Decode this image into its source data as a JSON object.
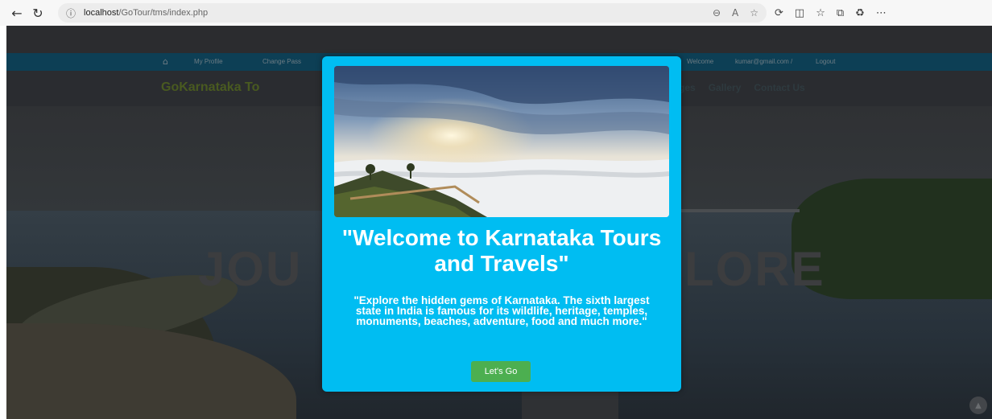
{
  "browser": {
    "back_icon": "←",
    "refresh_icon": "↻",
    "info_icon": "ⓘ",
    "url_host": "localhost",
    "url_path": "/GoTour/tms/index.php",
    "zoom_icon": "⊖",
    "read_aloud_icon": "A",
    "favorite_icon": "☆",
    "toolbar_icons": [
      "⟳",
      "◫",
      "☆",
      "⧉",
      "♻",
      "⋯"
    ]
  },
  "site": {
    "menu": {
      "home_icon": "⌂",
      "my_profile": "My Profile",
      "change_password": "Change Pass",
      "welcome": "Welcome",
      "email": "kumar@gmail.com /",
      "logout": "Logout"
    },
    "brand": "GoKarnataka To",
    "nav": [
      "ges",
      "Gallery",
      "Contact Us"
    ],
    "hero_left": "JOU",
    "hero_right": "LORE"
  },
  "modal": {
    "title": "\"Welcome to Karnataka Tours and Travels\"",
    "text": "\"Explore the hidden gems of Karnataka. The sixth largest state in India is famous for its wildlife, heritage, temples, monuments, beaches, adventure, food and much more.\"",
    "button_label": "Let's Go"
  },
  "colors": {
    "modal_bg": "#00bdf2",
    "button_bg": "#4caf50",
    "menubar_bg": "#0d3f55"
  }
}
